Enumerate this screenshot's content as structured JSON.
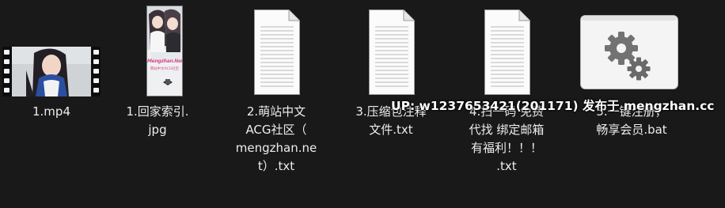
{
  "files": [
    {
      "name": "1.mp4",
      "lines": [
        "1.mp4"
      ],
      "icon": "video-thumbnail"
    },
    {
      "name": "1.回家索引.jpg",
      "lines": [
        "1.回家索引.",
        "jpg"
      ],
      "icon": "image-thumbnail"
    },
    {
      "name": "2.萌站中文ACG社区（mengzhan.net）.txt",
      "lines": [
        "2.萌站中文",
        "ACG社区（",
        "mengzhan.ne",
        "t）.txt"
      ],
      "icon": "text-document-icon"
    },
    {
      "name": "3.压缩包注释文件.txt",
      "lines": [
        "3.压缩包注释",
        "文件.txt"
      ],
      "icon": "text-document-icon"
    },
    {
      "name": "4.扫一码 免费代找 绑定邮箱有福利！！！.txt",
      "lines": [
        "4.扫一码 免费",
        "代找 绑定邮箱",
        "有福利！！！",
        ".txt"
      ],
      "icon": "text-document-icon"
    },
    {
      "name": "5.一键注册，畅享会员.bat",
      "lines": [
        "5.一键注册，",
        "畅享会员.bat"
      ],
      "icon": "gears-icon"
    }
  ],
  "thumbnail_text": {
    "jpg_title": "Mengzhan.Net",
    "jpg_sub": "萌站中文ACG社区"
  },
  "watermark": "UP: w1237653421(201171) 发布于 mengzhan.cc",
  "colors": {
    "background": "#191919",
    "label": "#ededed",
    "watermark": "#ffffff"
  }
}
